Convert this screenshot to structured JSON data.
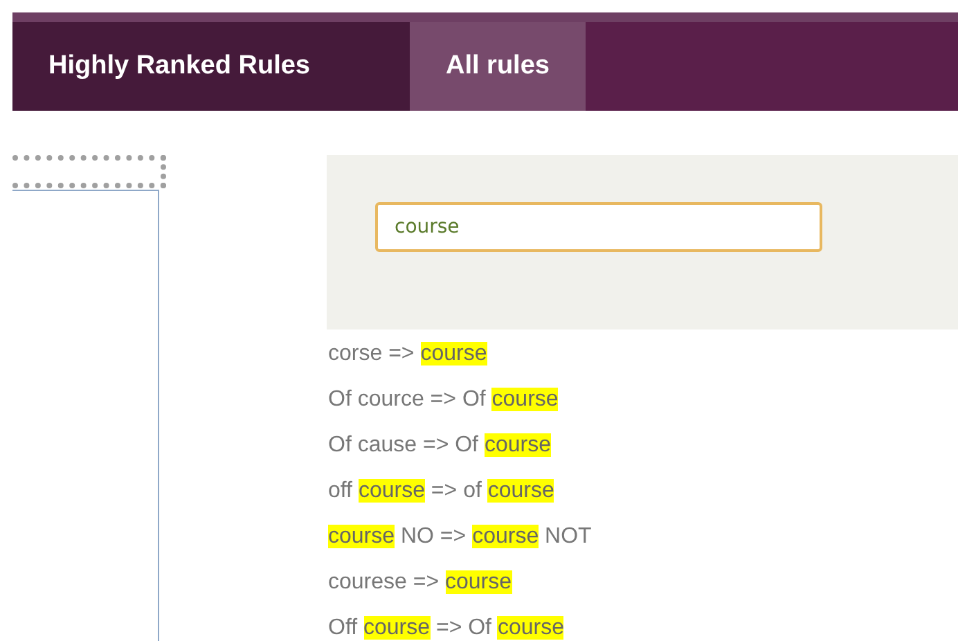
{
  "tabs": [
    {
      "label": "Highly Ranked Rules",
      "selected": false
    },
    {
      "label": "All rules",
      "selected": true
    }
  ],
  "search": {
    "value": "course"
  },
  "rules": [
    {
      "segments": [
        {
          "text": "corse => ",
          "highlight": false
        },
        {
          "text": "course",
          "highlight": true
        }
      ]
    },
    {
      "segments": [
        {
          "text": "Of cource => Of ",
          "highlight": false
        },
        {
          "text": "course",
          "highlight": true
        }
      ]
    },
    {
      "segments": [
        {
          "text": "Of cause => Of ",
          "highlight": false
        },
        {
          "text": "course",
          "highlight": true
        }
      ]
    },
    {
      "segments": [
        {
          "text": "off ",
          "highlight": false
        },
        {
          "text": "course",
          "highlight": true
        },
        {
          "text": " => of ",
          "highlight": false
        },
        {
          "text": "course",
          "highlight": true
        }
      ]
    },
    {
      "segments": [
        {
          "text": "course",
          "highlight": true
        },
        {
          "text": " NO => ",
          "highlight": false
        },
        {
          "text": "course",
          "highlight": true
        },
        {
          "text": " NOT",
          "highlight": false
        }
      ]
    },
    {
      "segments": [
        {
          "text": "courese => ",
          "highlight": false
        },
        {
          "text": "course",
          "highlight": true
        }
      ]
    },
    {
      "segments": [
        {
          "text": "Off ",
          "highlight": false
        },
        {
          "text": "course",
          "highlight": true
        },
        {
          "text": " => Of ",
          "highlight": false
        },
        {
          "text": "course",
          "highlight": true
        }
      ]
    }
  ]
}
